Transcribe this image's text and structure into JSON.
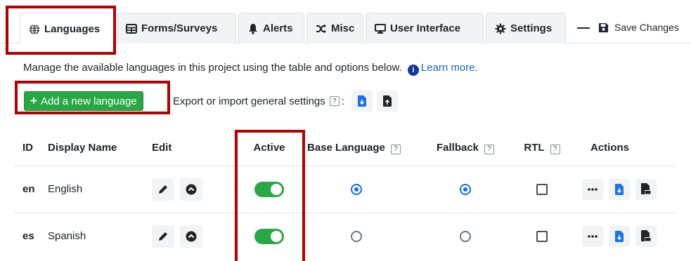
{
  "tabs": [
    {
      "label": "Languages",
      "icon": "globe-icon",
      "active": true
    },
    {
      "label": "Forms/Surveys",
      "icon": "table-icon",
      "active": false
    },
    {
      "label": "Alerts",
      "icon": "bell-icon",
      "active": false
    },
    {
      "label": "Misc",
      "icon": "shuffle-icon",
      "active": false
    },
    {
      "label": "User Interface",
      "icon": "monitor-icon",
      "active": false
    },
    {
      "label": "Settings",
      "icon": "gear-icon",
      "active": false
    }
  ],
  "toolbar": {
    "save_label": "Save Changes"
  },
  "description": {
    "text": "Manage the available languages in this project using the table and options below.",
    "learn_more": "Learn more.",
    "info_symbol": "i"
  },
  "add_language": {
    "label": "Add a new language",
    "plus": "+"
  },
  "export": {
    "label": "Export or import general settings",
    "help": "?",
    "colon": ":"
  },
  "table": {
    "headers": {
      "id": "ID",
      "name": "Display Name",
      "edit": "Edit",
      "active": "Active",
      "base": "Base Language",
      "fallback": "Fallback",
      "rtl": "RTL",
      "actions": "Actions"
    },
    "help_mark": "?",
    "rows": [
      {
        "id": "en",
        "name": "English",
        "active": true,
        "base": true,
        "fallback": true,
        "rtl": false
      },
      {
        "id": "es",
        "name": "Spanish",
        "active": true,
        "base": false,
        "fallback": false,
        "rtl": false
      }
    ]
  },
  "colors": {
    "accent_green": "#28a745",
    "highlight_red": "#b30000",
    "link_blue": "#1565c0",
    "radio_blue": "#0d6efd"
  }
}
